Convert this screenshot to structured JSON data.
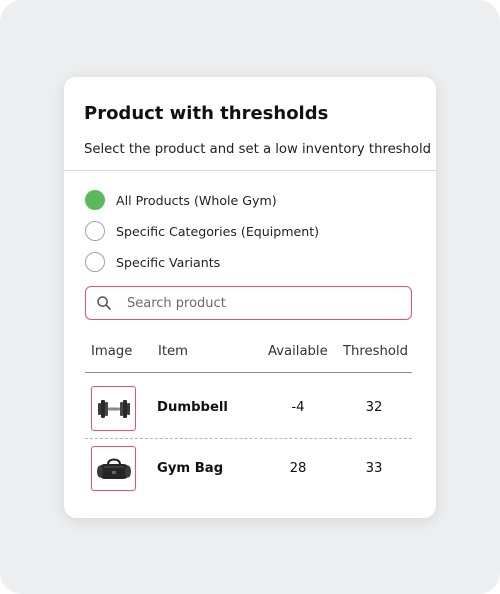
{
  "card": {
    "title": "Product with thresholds",
    "subtitle": "Select the product and set a low inventory threshold"
  },
  "scope_options": [
    {
      "label": "All Products (Whole Gym)",
      "selected": true
    },
    {
      "label": "Specific Categories (Equipment)",
      "selected": false
    },
    {
      "label": "Specific Variants",
      "selected": false
    }
  ],
  "search": {
    "placeholder": "Search product",
    "value": "",
    "icon": "search-icon"
  },
  "table": {
    "columns": [
      "Image",
      "Item",
      "Available",
      "Threshold"
    ],
    "rows": [
      {
        "image_icon": "dumbbell-icon",
        "item": "Dumbbell",
        "available": "-4",
        "threshold": "32"
      },
      {
        "image_icon": "gym-bag-icon",
        "item": "Gym Bag",
        "available": "28",
        "threshold": "33"
      }
    ]
  },
  "colors": {
    "accent_selected": "#5cb85c",
    "highlight_border": "#e0575f",
    "background": "#eceef0"
  }
}
